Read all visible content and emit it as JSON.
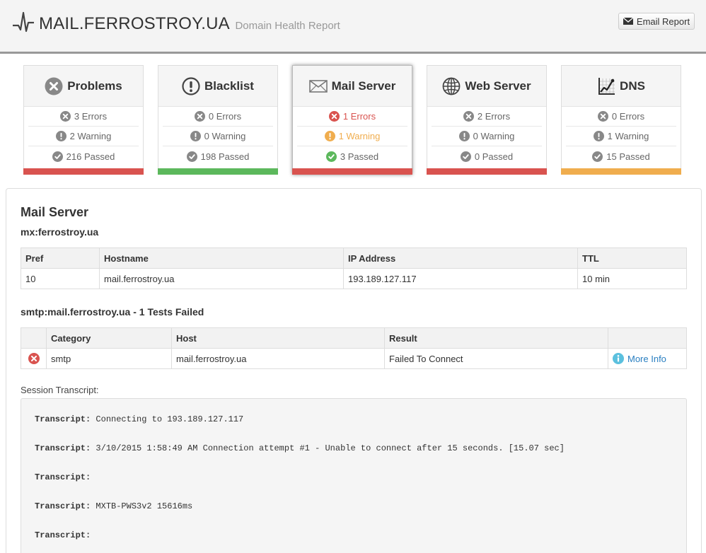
{
  "header": {
    "title": "MAIL.FERROSTROY.UA",
    "subtitle": "Domain Health Report",
    "email_button": "Email Report"
  },
  "cards": [
    {
      "title": "Problems",
      "icon": "x-circle-icon",
      "errors": "3 Errors",
      "warnings": "2 Warning",
      "passed": "216 Passed",
      "bar_color": "#d9534f"
    },
    {
      "title": "Blacklist",
      "icon": "exclamation-circle-icon",
      "errors": "0 Errors",
      "warnings": "0 Warning",
      "passed": "198 Passed",
      "bar_color": "#5cb85c"
    },
    {
      "title": "Mail Server",
      "icon": "envelope-icon",
      "errors": "1 Errors",
      "warnings": "1 Warning",
      "passed": "3 Passed",
      "bar_color": "#d9534f",
      "active": true
    },
    {
      "title": "Web Server",
      "icon": "globe-icon",
      "errors": "2 Errors",
      "warnings": "0 Warning",
      "passed": "0 Passed",
      "bar_color": "#d9534f"
    },
    {
      "title": "DNS",
      "icon": "chart-icon",
      "errors": "0 Errors",
      "warnings": "1 Warning",
      "passed": "15 Passed",
      "bar_color": "#f0ad4e"
    }
  ],
  "main": {
    "section_title": "Mail Server",
    "mx_title": "mx:ferrostroy.ua",
    "mx_table": {
      "headers": [
        "Pref",
        "Hostname",
        "IP Address",
        "TTL"
      ],
      "rows": [
        [
          "10",
          "mail.ferrostroy.ua",
          "193.189.127.117",
          "10 min"
        ]
      ]
    },
    "smtp_title": "smtp:mail.ferrostroy.ua - 1 Tests Failed",
    "smtp_table": {
      "headers": [
        "",
        "Category",
        "Host",
        "Result",
        ""
      ],
      "rows": [
        {
          "category": "smtp",
          "host": "mail.ferrostroy.ua",
          "result": "Failed To Connect",
          "link": "More Info"
        }
      ]
    },
    "transcript_label": "Session Transcript:",
    "transcript": [
      {
        "label": "Transcript:",
        "text": "Connecting to 193.189.127.117"
      },
      {
        "label": "Transcript:",
        "text": "3/10/2015 1:58:49 AM Connection attempt #1 - Unable to connect after 15 seconds. [15.07 sec]"
      },
      {
        "label": "Transcript:",
        "text": ""
      },
      {
        "label": "Transcript:",
        "text": "MXTB-PWS3v2 15616ms"
      },
      {
        "label": "Transcript:",
        "text": ""
      }
    ]
  },
  "colors": {
    "error": "#d9534f",
    "warning": "#f0ad4e",
    "success": "#5cb85c",
    "neutral": "#888888",
    "link": "#2a7fc1"
  }
}
